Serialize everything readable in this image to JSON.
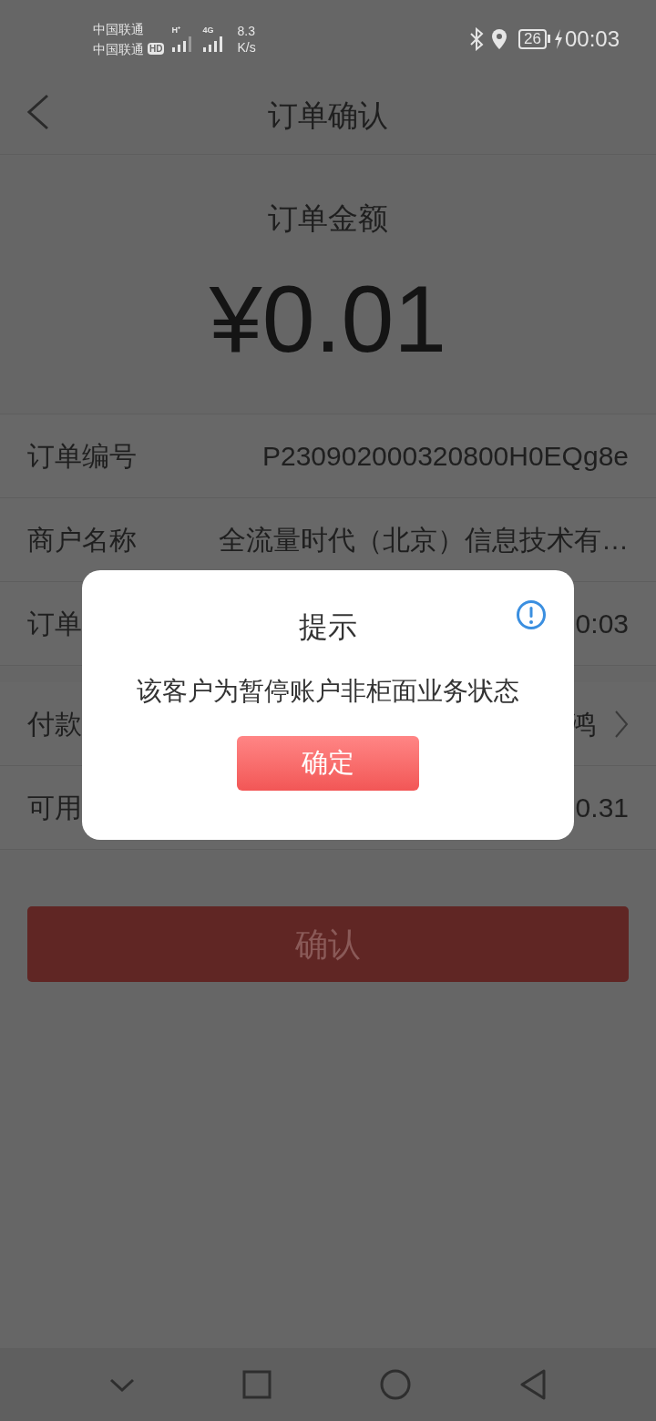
{
  "status_bar": {
    "carrier_1": "中国联通",
    "carrier_2": "中国联通",
    "hd_badge": "HD",
    "network_1": "H⁺",
    "network_2": "4G",
    "speed": "8.3",
    "speed_unit": "K/s",
    "battery": "26",
    "time": "00:03"
  },
  "header": {
    "title": "订单确认"
  },
  "amount": {
    "label": "订单金额",
    "value": "¥0.01"
  },
  "order_rows": [
    {
      "label": "订单编号",
      "value": "P230902000320800H0EQg8e",
      "chevron": false
    },
    {
      "label": "商户名称",
      "value": "全流量时代（北京）信息技术有…",
      "chevron": false
    },
    {
      "label": "订单",
      "value": "0:03",
      "chevron": false
    }
  ],
  "payment_rows": [
    {
      "label": "付款",
      "value": "鸿",
      "chevron": true
    },
    {
      "label": "可用",
      "value": "0.31",
      "chevron": false
    }
  ],
  "confirm_button": "确认",
  "dialog": {
    "title": "提示",
    "message": "该客户为暂停账户非柜面业务状态",
    "button": "确定"
  }
}
